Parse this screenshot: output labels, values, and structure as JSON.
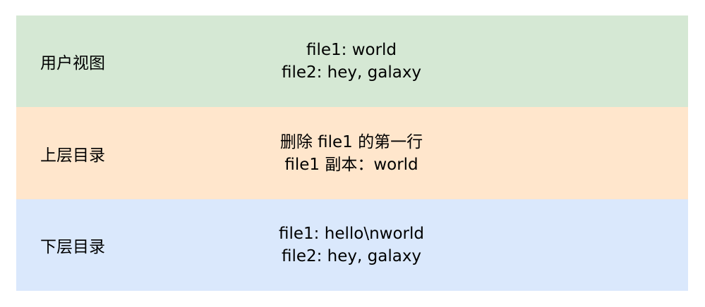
{
  "layers": [
    {
      "label": "用户视图",
      "lines": [
        "file1: world",
        "file2: hey, galaxy"
      ],
      "color": "#d5e8d4"
    },
    {
      "label": "上层目录",
      "lines": [
        "删除 file1 的第一行",
        "file1 副本：world"
      ],
      "color": "#ffe6cc"
    },
    {
      "label": "下层目录",
      "lines": [
        "file1: hello\\nworld",
        "file2: hey, galaxy"
      ],
      "color": "#dae8fc"
    }
  ]
}
